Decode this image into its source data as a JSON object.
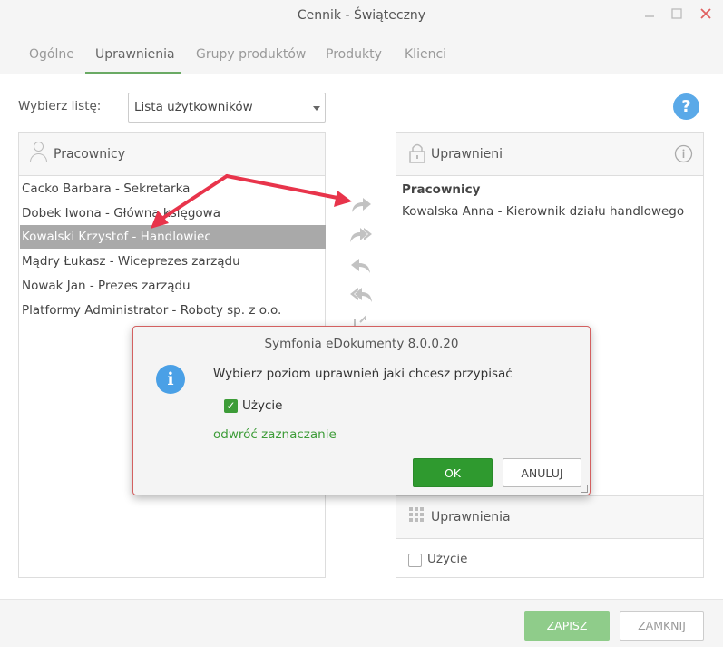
{
  "window": {
    "title": "Cennik - Świąteczny"
  },
  "tabs": [
    {
      "label": "Ogólne"
    },
    {
      "label": "Uprawnienia"
    },
    {
      "label": "Grupy produktów"
    },
    {
      "label": "Produkty"
    },
    {
      "label": "Klienci"
    }
  ],
  "list_selector": {
    "label": "Wybierz listę:",
    "value": "Lista użytkowników"
  },
  "left_panel": {
    "title": "Pracownicy",
    "items": [
      "Cacko Barbara - Sekretarka",
      "Dobek Iwona - Główna księgowa",
      "Kowalski Krzystof - Handlowiec",
      "Mądry Łukasz - Wiceprezes zarządu",
      "Nowak Jan - Prezes zarządu",
      "Platformy Administrator - Roboty sp. z o.o."
    ],
    "selected_index": 2
  },
  "right_panel": {
    "title": "Uprawnieni",
    "group_label": "Pracownicy",
    "items": [
      "Kowalska Anna - Kierownik działu handlowego"
    ]
  },
  "permissions_panel": {
    "title": "Uprawnienia",
    "checkbox_label": "Użycie"
  },
  "dialog": {
    "title": "Symfonia eDokumenty 8.0.0.20",
    "message": "Wybierz poziom uprawnień jaki chcesz przypisać",
    "checkbox_label": "Użycie",
    "link": "odwróć zaznaczanie",
    "ok_label": "OK",
    "cancel_label": "ANULUJ"
  },
  "footer": {
    "save_label": "ZAPISZ",
    "close_label": "ZAMKNIJ"
  },
  "colors": {
    "accent_green": "#2f9a2f",
    "info_blue": "#4aa0e6",
    "annotation_red": "#e8344b"
  }
}
